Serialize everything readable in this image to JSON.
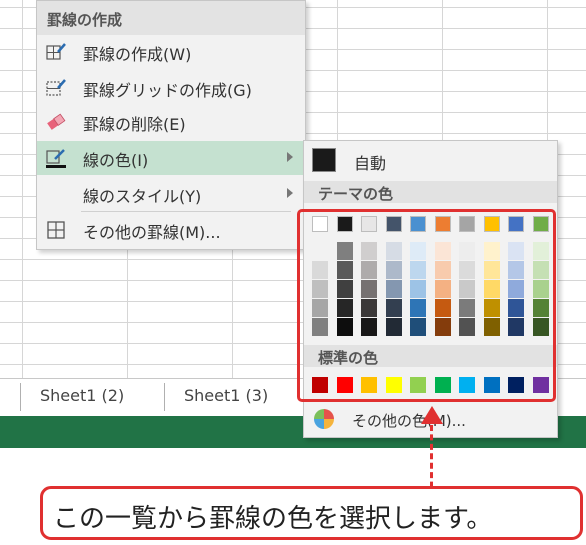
{
  "sheet_tabs": [
    "Sheet1 (2)",
    "Sheet1 (3)"
  ],
  "menu1": {
    "header": "罫線の作成",
    "items": [
      {
        "label": "罫線の作成(W)",
        "icon": "draw-border-icon"
      },
      {
        "label": "罫線グリッドの作成(G)",
        "icon": "draw-border-grid-icon"
      },
      {
        "label": "罫線の削除(E)",
        "icon": "eraser-icon"
      },
      {
        "label": "線の色(I)",
        "icon": "line-color-icon",
        "has_submenu": true,
        "highlighted": true
      },
      {
        "label": "線のスタイル(Y)",
        "icon": "",
        "has_submenu": true
      },
      {
        "label": "その他の罫線(M)...",
        "icon": "borders-grid-icon"
      }
    ]
  },
  "menu2": {
    "auto_label": "自動",
    "theme_header": "テーマの色",
    "standard_header": "標準の色",
    "more_label": "その他の色(M)..."
  },
  "theme_colors": [
    [
      "#ffffff",
      "#f2f2f2",
      "#d9d9d9",
      "#bfbfbf",
      "#a6a6a6",
      "#808080"
    ],
    [
      "#1a1a1a",
      "#7f7f7f",
      "#595959",
      "#404040",
      "#262626",
      "#0d0d0d"
    ],
    [
      "#e7e6e6",
      "#d0cece",
      "#aeabab",
      "#767171",
      "#3b3838",
      "#181717"
    ],
    [
      "#44546a",
      "#d6dce5",
      "#adb9ca",
      "#8497b0",
      "#333f50",
      "#222a35"
    ],
    [
      "#4a90d0",
      "#deebf7",
      "#bdd7ee",
      "#9dc3e6",
      "#2e75b6",
      "#1f4e79"
    ],
    [
      "#ed7d31",
      "#fbe5d6",
      "#f8cbad",
      "#f4b183",
      "#c55a11",
      "#843c0c"
    ],
    [
      "#a5a5a5",
      "#ededed",
      "#dbdbdb",
      "#c9c9c9",
      "#7b7b7b",
      "#525252"
    ],
    [
      "#ffc000",
      "#fff2cc",
      "#ffe699",
      "#ffd966",
      "#bf9000",
      "#7f6000"
    ],
    [
      "#4472c4",
      "#dae3f3",
      "#b4c7e7",
      "#8faadc",
      "#2f5597",
      "#203864"
    ],
    [
      "#70ad47",
      "#e2f0d9",
      "#c5e0b4",
      "#a9d18e",
      "#548235",
      "#375623"
    ]
  ],
  "standard_colors": [
    "#c00000",
    "#ff0000",
    "#ffc000",
    "#ffff00",
    "#92d050",
    "#00b050",
    "#00b0f0",
    "#0070c0",
    "#002060",
    "#7030a0"
  ],
  "callout": "この一覧から罫線の色を選択します。",
  "accent_colors": {
    "highlight": "#e03030",
    "status_bar": "#217346",
    "menu_hover": "#c5e1d0"
  }
}
